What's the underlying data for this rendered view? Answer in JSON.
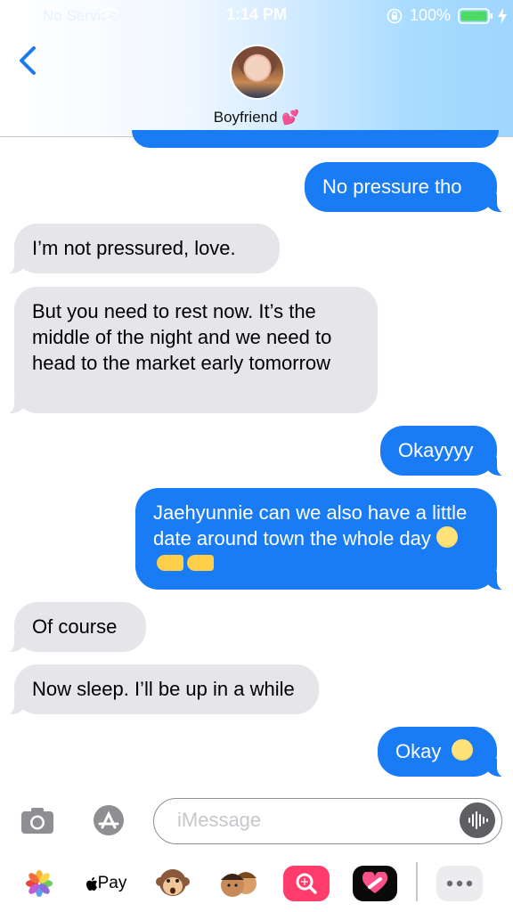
{
  "status_bar": {
    "carrier": "No Service",
    "time": "1:14 PM",
    "battery": "100%"
  },
  "header": {
    "contact_name": "Boyfriend",
    "contact_emoji": "💕",
    "back_icon": "chevron-left-icon"
  },
  "messages": [
    {
      "from": "me",
      "text": "No pressure tho"
    },
    {
      "from": "them",
      "text": "I’m not pressured, love."
    },
    {
      "from": "them",
      "text": "But you need to rest now. It’s the middle of the night and we need to head to the market early tomorrow"
    },
    {
      "from": "me",
      "text": "Okayyyy"
    },
    {
      "from": "me",
      "text": "Jaehyunnie can we also have a little date around town the whole day"
    },
    {
      "from": "them",
      "text": "Of course"
    },
    {
      "from": "them",
      "text": "Now sleep. I’ll be up in a while"
    },
    {
      "from": "me",
      "text": "Okay"
    }
  ],
  "input": {
    "placeholder": "iMessage"
  },
  "drawer": {
    "apple_pay_label": "Pay",
    "apps": [
      "photos-icon",
      "apple-pay-icon",
      "monkey-emoji-icon",
      "memoji-icon",
      "image-search-icon",
      "heart-app-icon",
      "more-icon"
    ]
  },
  "colors": {
    "sent_bubble": "#1a7cf5",
    "received_bubble": "#e5e5ea",
    "accent": "#1a7cf5"
  }
}
